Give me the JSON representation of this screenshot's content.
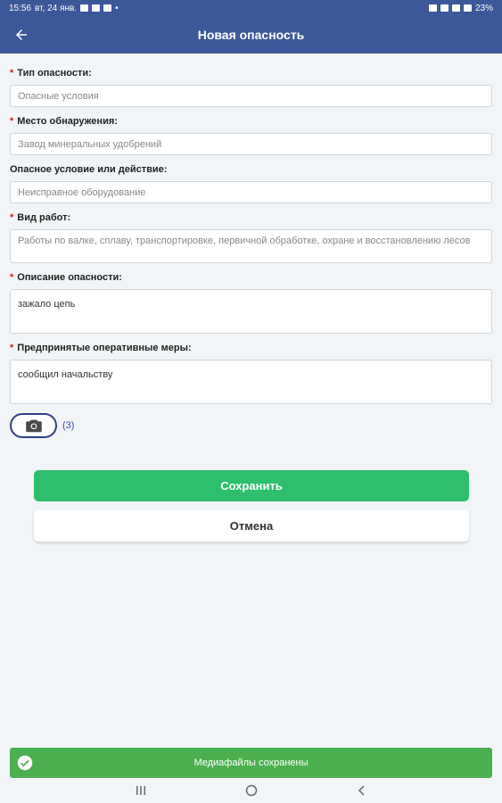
{
  "status_bar": {
    "time": "15:56",
    "date": "вт, 24 янв.",
    "battery": "23%"
  },
  "app_bar": {
    "title": "Новая опасность"
  },
  "form": {
    "fields": [
      {
        "label": "Тип опасности:",
        "required": true,
        "value": "Опасные условия"
      },
      {
        "label": "Место обнаружения:",
        "required": true,
        "value": "Завод минеральных удобрений"
      },
      {
        "label": "Опасное условие или действие:",
        "required": false,
        "value": "Неисправное оборудование"
      },
      {
        "label": "Вид работ:",
        "required": true,
        "value": "Работы по валке, сплаву, транспортировке, первичной обработке, охране и восстановлению лесов"
      },
      {
        "label": "Описание опасности:",
        "required": true,
        "value": "зажало цепь"
      },
      {
        "label": "Предпринятые оперативные меры:",
        "required": true,
        "value": "сообщил начальству"
      }
    ],
    "required_mark": "*",
    "photo_count": "(3)"
  },
  "buttons": {
    "save": "Сохранить",
    "cancel": "Отмена"
  },
  "toast": {
    "text": "Медиафайлы сохранены"
  },
  "icons": {
    "back": "arrow-left-icon",
    "camera": "camera-icon",
    "toast": "check-circle-icon",
    "nav": [
      "recents-icon",
      "home-icon",
      "back-icon"
    ]
  },
  "colors": {
    "primary": "#3b5998",
    "save": "#2dbf6c",
    "toast": "#4caf50",
    "required": "#d62020"
  }
}
